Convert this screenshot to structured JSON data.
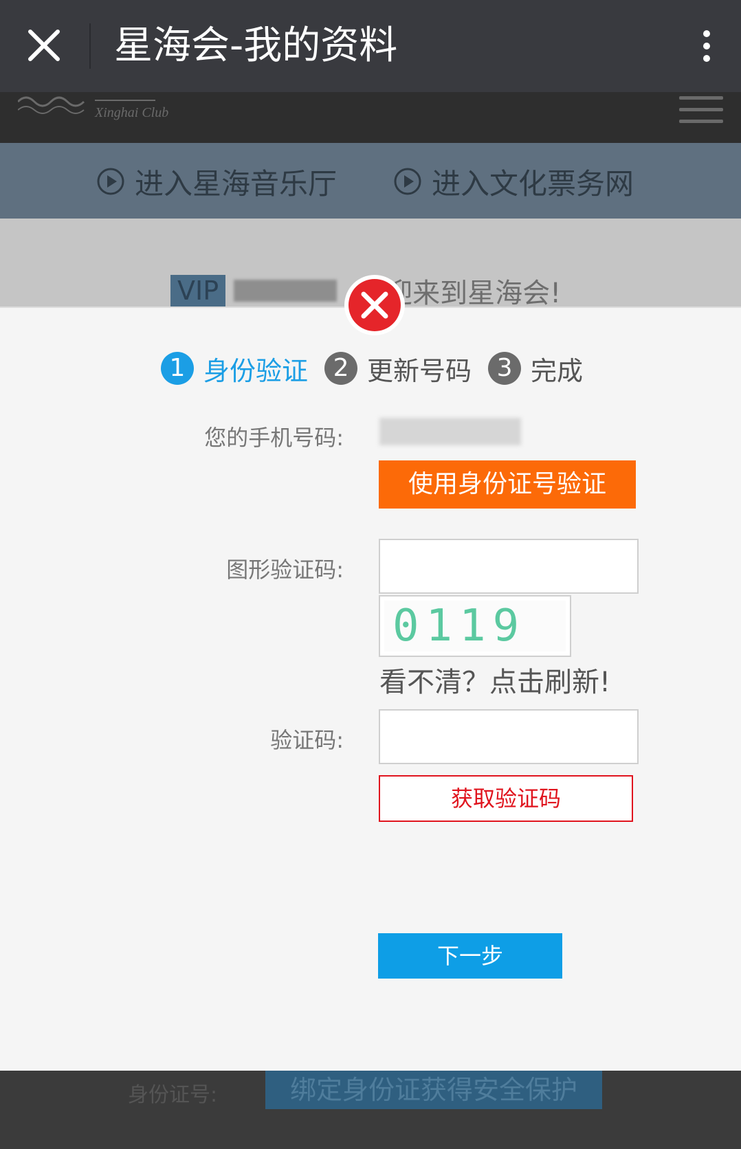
{
  "window": {
    "title": "星海会-我的资料",
    "close_icon": "close-icon",
    "more_icon": "more-vertical-icon"
  },
  "site": {
    "logo_text": "星海会 Xinghai Club",
    "links": [
      {
        "label": "进入星海音乐厅",
        "icon": "play-circle-icon"
      },
      {
        "label": "进入文化票务网",
        "icon": "play-circle-icon"
      }
    ],
    "vip_badge": "VIP",
    "welcome_text": "欢迎来到星海会!",
    "bottom_label": "身份证号:",
    "bind_button": "绑定身份证获得安全保护"
  },
  "dialog": {
    "status_icon": "error-icon",
    "colors": {
      "accent": "#1b9ee5",
      "orange": "#fc6a08",
      "red": "#e0141e",
      "next": "#0e9ee6"
    },
    "steps": [
      {
        "num": "1",
        "label": "身份验证",
        "active": true
      },
      {
        "num": "2",
        "label": "更新号码",
        "active": false
      },
      {
        "num": "3",
        "label": "完成",
        "active": false
      }
    ],
    "phone_label": "您的手机号码:",
    "id_verify_button": "使用身份证号验证",
    "captcha_label": "图形验证码:",
    "captcha_value": "",
    "captcha_image_text": "0119",
    "refresh_text": "看不清？点击刷新!",
    "code_label": "验证码:",
    "code_value": "",
    "get_code_button": "获取验证码",
    "next_button": "下一步"
  }
}
